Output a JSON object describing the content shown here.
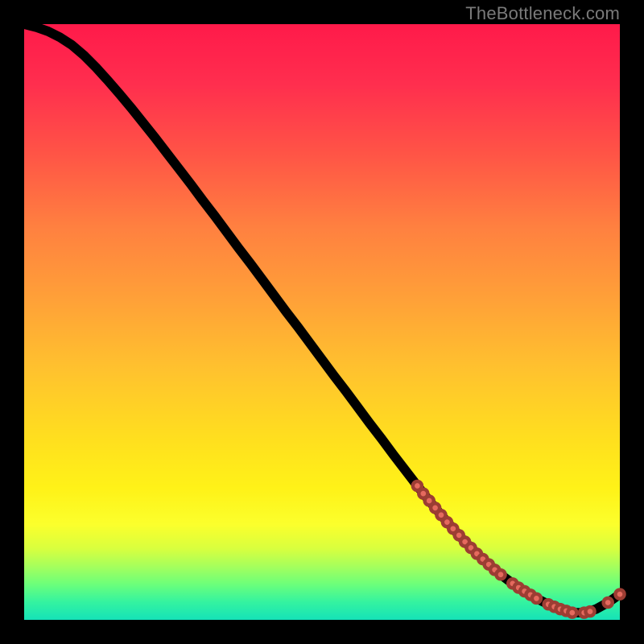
{
  "watermark": "TheBottleneck.com",
  "colors": {
    "marker_fill": "#e56a5e",
    "marker_stroke": "#9c3d33",
    "curve": "#000000"
  },
  "chart_data": {
    "type": "line",
    "title": "",
    "xlabel": "",
    "ylabel": "",
    "xlim": [
      0,
      100
    ],
    "ylim": [
      0,
      100
    ],
    "x": [
      0,
      2,
      4,
      6,
      8,
      10,
      12,
      14,
      16,
      18,
      20,
      22,
      24,
      26,
      28,
      30,
      32,
      34,
      36,
      38,
      40,
      42,
      44,
      46,
      48,
      50,
      52,
      54,
      56,
      58,
      60,
      62,
      64,
      66,
      68,
      70,
      72,
      74,
      76,
      78,
      80,
      82,
      84,
      86,
      88,
      90,
      92,
      94,
      96,
      98,
      100
    ],
    "values": [
      100,
      99.5,
      98.8,
      97.8,
      96.5,
      94.8,
      92.8,
      90.6,
      88.3,
      85.9,
      83.4,
      80.9,
      78.3,
      75.7,
      73.1,
      70.4,
      67.8,
      65.1,
      62.4,
      59.8,
      57.1,
      54.4,
      51.7,
      49.1,
      46.4,
      43.7,
      41.0,
      38.4,
      35.7,
      33.0,
      30.4,
      27.7,
      25.1,
      22.5,
      20.0,
      17.6,
      15.3,
      13.1,
      11.1,
      9.3,
      7.6,
      6.1,
      4.8,
      3.6,
      2.6,
      1.8,
      1.2,
      1.2,
      1.8,
      2.9,
      4.3
    ],
    "series": [
      {
        "name": "markers",
        "x": [
          66,
          67,
          68,
          69,
          70,
          71,
          72,
          73,
          74,
          75,
          76,
          77,
          78,
          79,
          80,
          82,
          83,
          84,
          85,
          86,
          88,
          89,
          90,
          91,
          92,
          94,
          95,
          98,
          100
        ],
        "values": [
          22.5,
          21.2,
          20.0,
          18.8,
          17.6,
          16.4,
          15.3,
          14.2,
          13.1,
          12.1,
          11.1,
          10.2,
          9.3,
          8.4,
          7.6,
          6.1,
          5.4,
          4.8,
          4.2,
          3.6,
          2.6,
          2.2,
          1.8,
          1.5,
          1.2,
          1.2,
          1.4,
          2.9,
          4.3
        ]
      }
    ]
  }
}
